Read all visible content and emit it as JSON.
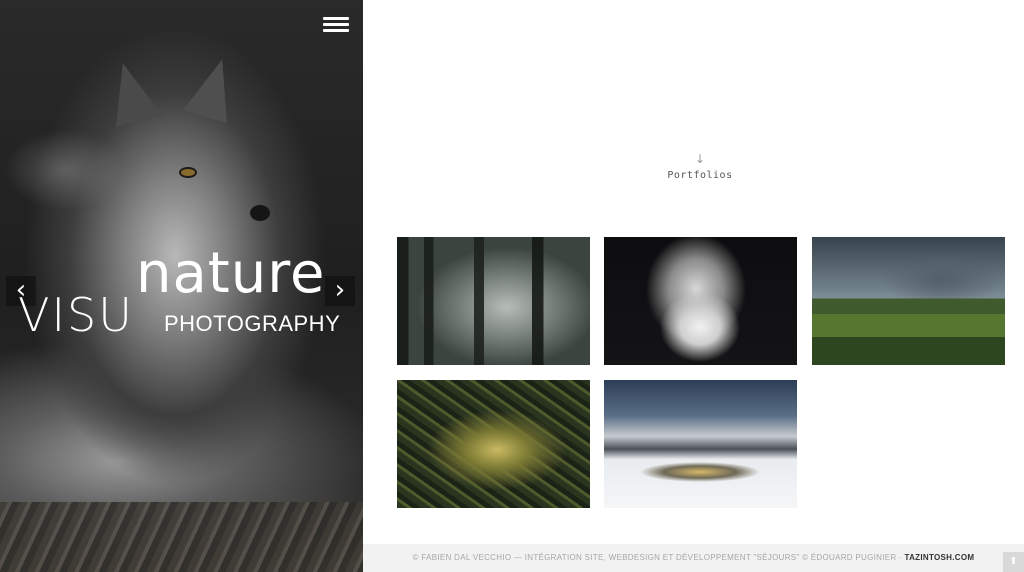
{
  "hero": {
    "logo": {
      "prefix": "VISU",
      "word": "nature",
      "sub": "PHOTOGRAPHY"
    },
    "menu_icon": "hamburger-menu-icon",
    "prev_icon": "chevron-left-icon",
    "next_icon": "chevron-right-icon",
    "prev_glyph": "‹",
    "next_glyph": "›"
  },
  "portfolios": {
    "arrow_glyph": "↓",
    "label": "Portfolios",
    "items": [
      {
        "subject": "misty forest"
      },
      {
        "subject": "arctic fox"
      },
      {
        "subject": "green valley and mountain"
      },
      {
        "subject": "mossy fallen tree"
      },
      {
        "subject": "snowy mountains and pool"
      }
    ]
  },
  "footer": {
    "credit": "© FABIEN DAL VECCHIO — INTÉGRATION SITE, WEBDESIGN ET DÉVELOPPEMENT \"SÉJOURS\" © ÉDOUARD PUGINIER · ",
    "link": "TAZINTOSH.COM",
    "to_top_glyph": "⬆",
    "to_top_icon": "arrow-up-icon"
  }
}
